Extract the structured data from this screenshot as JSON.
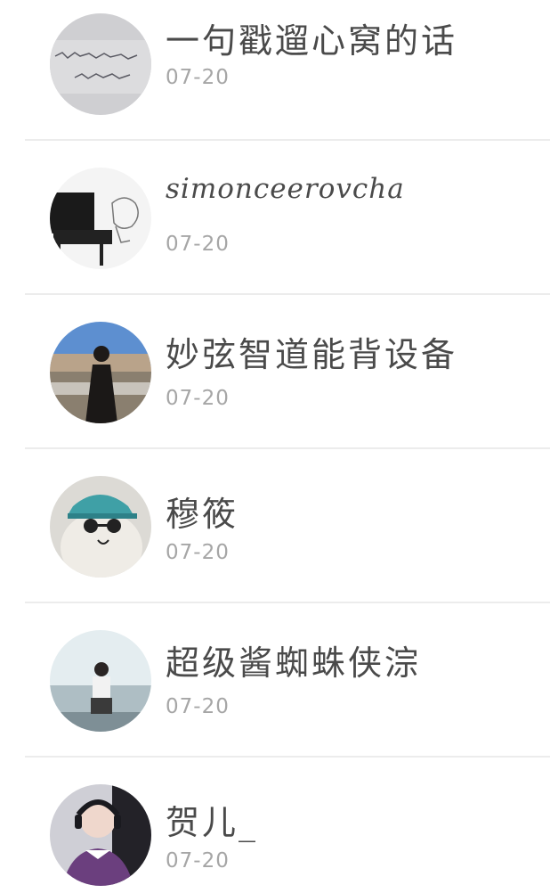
{
  "contacts": [
    {
      "name": "一句戳遛心窝的话",
      "date": "07-20",
      "avatar": "handwriting-note-avatar"
    },
    {
      "name": "simonceerovcha",
      "date": "07-20",
      "avatar": "piano-sketch-avatar"
    },
    {
      "name": "妙弦智道能背设备",
      "date": "07-20",
      "avatar": "beach-girl-avatar"
    },
    {
      "name": "穆筱",
      "date": "07-20",
      "avatar": "cat-with-cap-avatar"
    },
    {
      "name": "超级酱蜘蛛侠淙",
      "date": "07-20",
      "avatar": "sitting-boy-avatar"
    },
    {
      "name": "贺儿_",
      "date": "07-20",
      "avatar": "boy-with-headphones-avatar"
    }
  ]
}
